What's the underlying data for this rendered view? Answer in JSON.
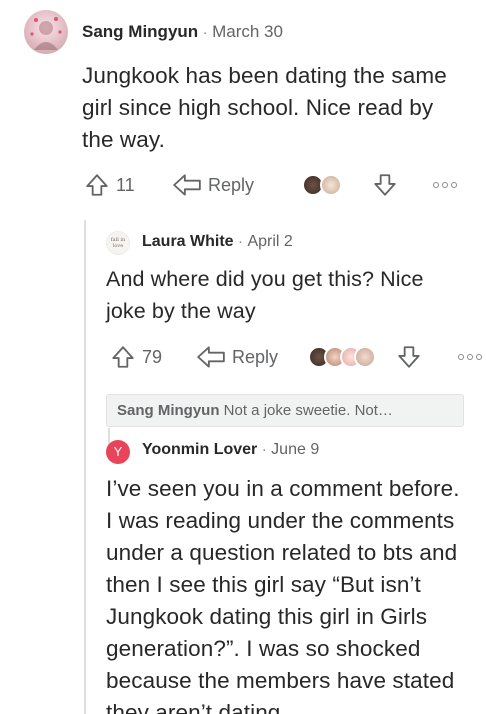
{
  "comments": [
    {
      "author": "Sang Mingyun",
      "date": "March 30",
      "body": "Jungkook has been dating the same girl since high school. Nice read by the way.",
      "upvotes": "11",
      "reply_label": "Reply"
    },
    {
      "author": "Laura White",
      "date": "April 2",
      "avatar_text": "fall in love",
      "body": "And where did you get this? Nice joke by the way",
      "upvotes": "79",
      "reply_label": "Reply"
    },
    {
      "author": "Yoonmin Lover",
      "date": "June 9",
      "avatar_letter": "Y",
      "body": "I’ve seen you in a comment before. I was reading under the comments under a question related to bts and then I see this girl say “But isn’t Jungkook dating this girl in Girls generation?”. I was so shocked because the members have stated they aren’t dating"
    }
  ],
  "collapsed_reply": {
    "author": "Sang Mingyun",
    "preview": "Not a joke sweetie. Not…"
  },
  "separator": "·",
  "colors": {
    "yoonmin_avatar": "#e8445a",
    "thread_line": "#dedede",
    "muted_text": "#636466"
  },
  "icons": [
    "upvote-icon",
    "share-icon",
    "downvote-icon",
    "more-icon"
  ]
}
